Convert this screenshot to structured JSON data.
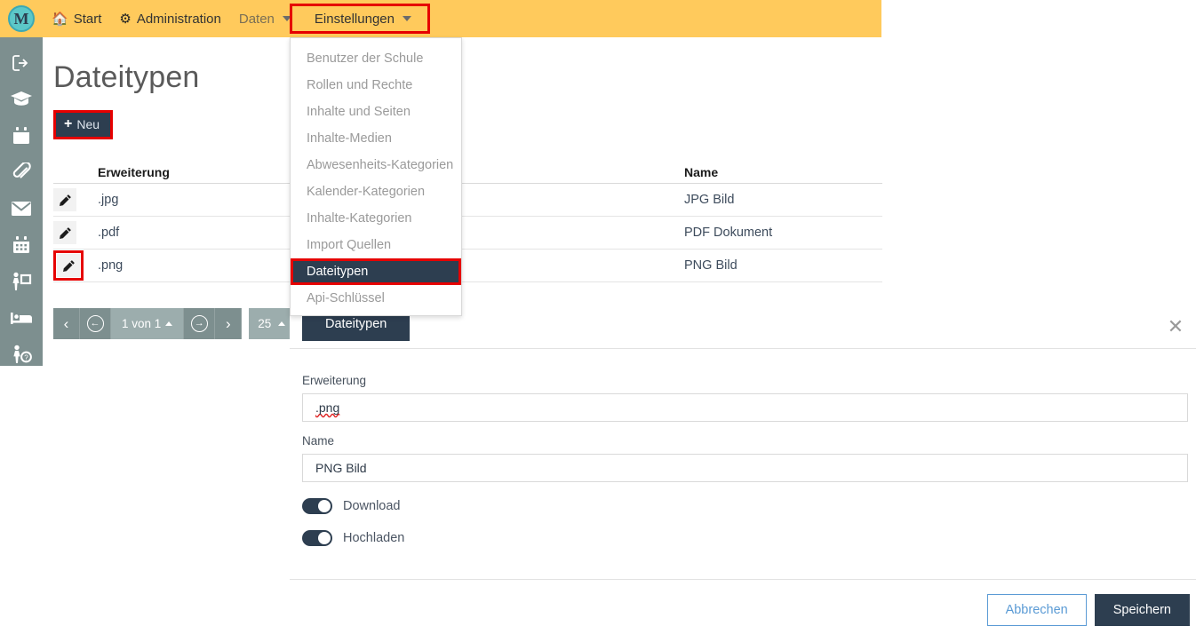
{
  "app": {
    "logo_letter": "M",
    "logo_icon": "circle-m-logo"
  },
  "topnav": {
    "items": [
      {
        "label": "Start",
        "icon": "home-icon",
        "has_caret": false
      },
      {
        "label": "Administration",
        "icon": "gear-icon",
        "has_caret": false
      },
      {
        "label": "Daten",
        "icon": "",
        "has_caret": true
      },
      {
        "label": "Einstellungen",
        "icon": "",
        "has_caret": true
      }
    ],
    "highlighted_item": "Einstellungen"
  },
  "sidebar": {
    "items": [
      {
        "icon": "logout-icon",
        "label": "Abmelden"
      },
      {
        "icon": "graduation-cap-icon",
        "label": "Schule"
      },
      {
        "icon": "calendar-icon",
        "label": "Kalender"
      },
      {
        "icon": "paperclip-icon",
        "label": "Anhaenge"
      },
      {
        "icon": "envelope-icon",
        "label": "Nachrichten"
      },
      {
        "icon": "calendar-grid-icon",
        "label": "Stundenplan"
      },
      {
        "icon": "person-presentation-icon",
        "label": "Unterricht"
      },
      {
        "icon": "bed-icon",
        "label": "Internat"
      },
      {
        "icon": "person-question-icon",
        "label": "Abwesenheit"
      }
    ]
  },
  "page": {
    "title": "Dateitypen",
    "new_button": {
      "label": "Neu",
      "plus": "+"
    }
  },
  "table": {
    "columns": [
      "Erweiterung",
      "Name"
    ],
    "edit_icon": "pencil-icon",
    "rows": [
      {
        "extension": ".jpg",
        "name": "JPG Bild",
        "highlighted": false
      },
      {
        "extension": ".pdf",
        "name": "PDF Dokument",
        "highlighted": false
      },
      {
        "extension": ".png",
        "name": "PNG Bild",
        "highlighted": true
      }
    ]
  },
  "pagination": {
    "first_label": "‹",
    "prev_icon": "arrow-left-circle-icon",
    "prev_glyph": "←",
    "page_label": "1 von 1",
    "next_icon": "arrow-right-circle-icon",
    "next_glyph": "→",
    "last_label": "›",
    "page_size": "25"
  },
  "dropdown": {
    "items": [
      {
        "label": "Benutzer der Schule",
        "active": false
      },
      {
        "label": "Rollen und Rechte",
        "active": false
      },
      {
        "label": "Inhalte und Seiten",
        "active": false
      },
      {
        "label": "Inhalte-Medien",
        "active": false
      },
      {
        "label": "Abwesenheits-Kategorien",
        "active": false
      },
      {
        "label": "Kalender-Kategorien",
        "active": false
      },
      {
        "label": "Inhalte-Kategorien",
        "active": false
      },
      {
        "label": "Import Quellen",
        "active": false
      },
      {
        "label": "Dateitypen",
        "active": true
      },
      {
        "label": "Api-Schlüssel",
        "active": false
      }
    ]
  },
  "panel": {
    "tab_label": "Dateitypen",
    "close_icon": "close-icon",
    "close_glyph": "✕",
    "fields": [
      {
        "label": "Erweiterung",
        "value": ".png",
        "spellcheck_error": true
      },
      {
        "label": "Name",
        "value": "PNG Bild",
        "spellcheck_error": false
      }
    ],
    "toggles": [
      {
        "label": "Download",
        "on": true
      },
      {
        "label": "Hochladen",
        "on": true
      }
    ],
    "cancel_label": "Abbrechen",
    "save_label": "Speichern"
  },
  "colors": {
    "topbar": "#ffca5c",
    "sidebar": "#7d8f8f",
    "accent_dark": "#2d3e50",
    "highlight_red": "#e60000",
    "link_blue": "#5b9bd5"
  }
}
